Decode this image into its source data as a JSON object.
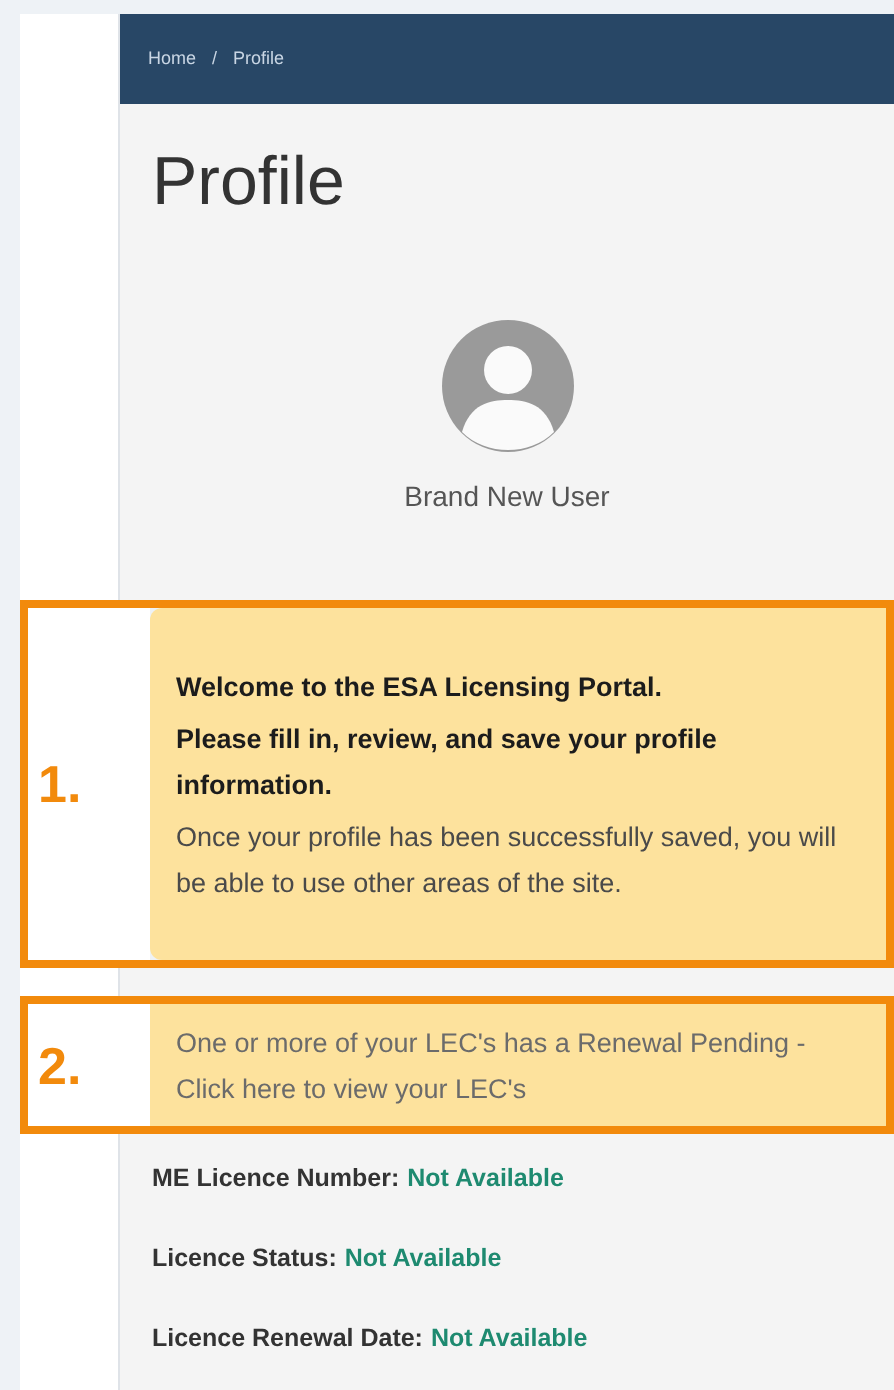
{
  "breadcrumb": [
    {
      "label": "Home"
    },
    {
      "label": "Profile"
    }
  ],
  "breadcrumb_separator": "/",
  "page_title": "Profile",
  "user": {
    "name": "Brand New User"
  },
  "callouts": [
    {
      "number": "1.",
      "kind": "welcome",
      "heading": [
        "Welcome to the ESA Licensing Portal.",
        "Please fill in, review, and save your profile information."
      ],
      "body": "Once your profile has been successfully saved, you will be able to use other areas of the site."
    },
    {
      "number": "2.",
      "kind": "link",
      "body": "One or more of your LEC's has a Renewal Pending - Click here to view your LEC's"
    }
  ],
  "fields": [
    {
      "label": "ME Licence Number:",
      "value": "Not Available"
    },
    {
      "label": "Licence Status:",
      "value": "Not Available"
    },
    {
      "label": "Licence Renewal Date:",
      "value": "Not Available"
    }
  ]
}
